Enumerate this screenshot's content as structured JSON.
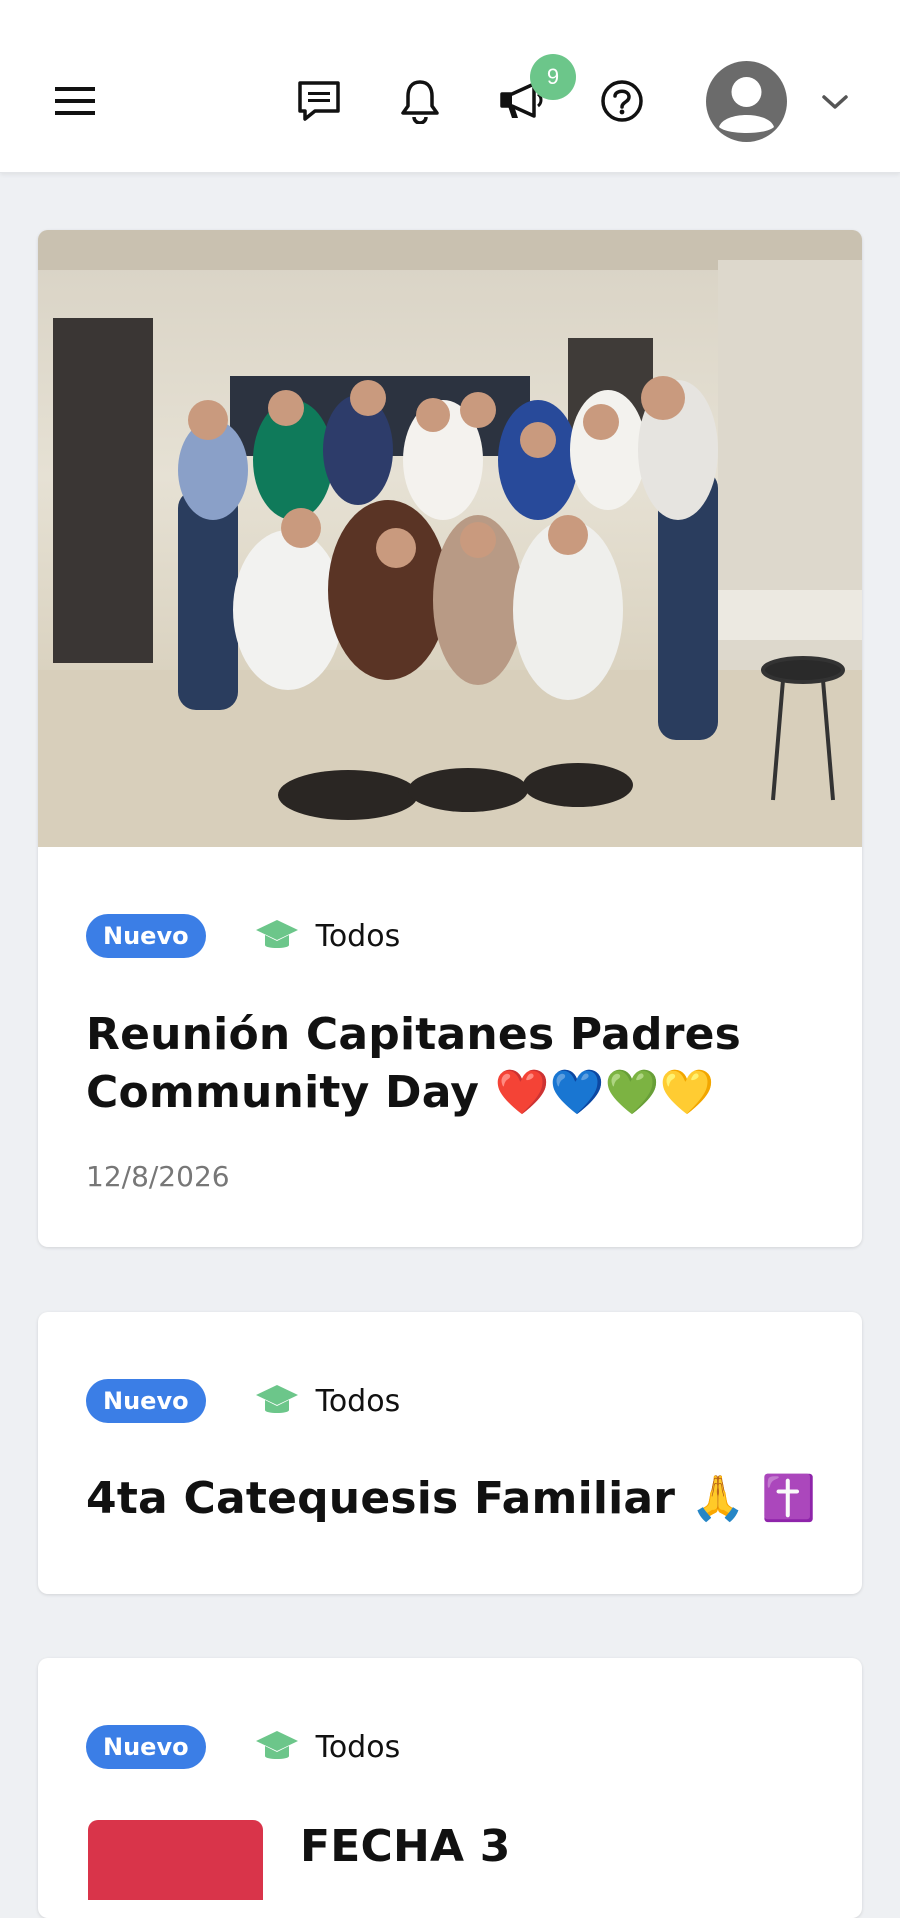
{
  "header": {
    "notification_count": "9",
    "icons": [
      "menu-icon",
      "chat-icon",
      "bell-icon",
      "megaphone-icon",
      "help-icon",
      "avatar-icon",
      "chevron-down-icon"
    ]
  },
  "posts": [
    {
      "tag": "Nuevo",
      "audience": "Todos",
      "title": "Reunión Capitanes Padres Community Day ❤️💙💚💛",
      "date": "12/8/2026"
    },
    {
      "tag": "Nuevo",
      "audience": "Todos",
      "title": "4ta Catequesis Familiar 🙏 ✝️"
    },
    {
      "tag": "Nuevo",
      "audience": "Todos",
      "title": "FECHA 3"
    }
  ],
  "colors": {
    "badge_new": "#3b7ee6",
    "audience_icon": "#6cc68a",
    "notification_badge": "#6cc68a"
  }
}
